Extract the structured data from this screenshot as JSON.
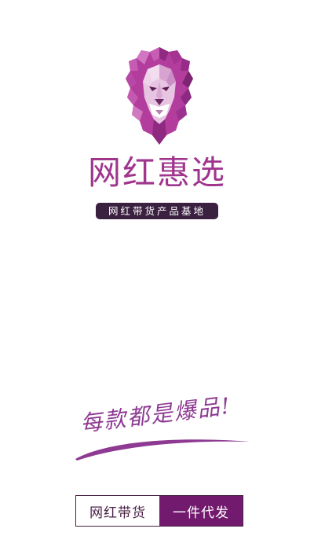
{
  "splash": {
    "logo_icon": "lion-icon",
    "app_name": "网红惠选",
    "tagline": "网红带货产品基地",
    "slogan": "每款都是爆品!",
    "banner": {
      "left_text": "网红带货",
      "right_text": "一件代发"
    }
  },
  "colors": {
    "brand_purple": "#a0358e",
    "dark_plum": "#3b2140",
    "banner_purple": "#721a6d",
    "slogan_purple": "#8e3a93"
  }
}
